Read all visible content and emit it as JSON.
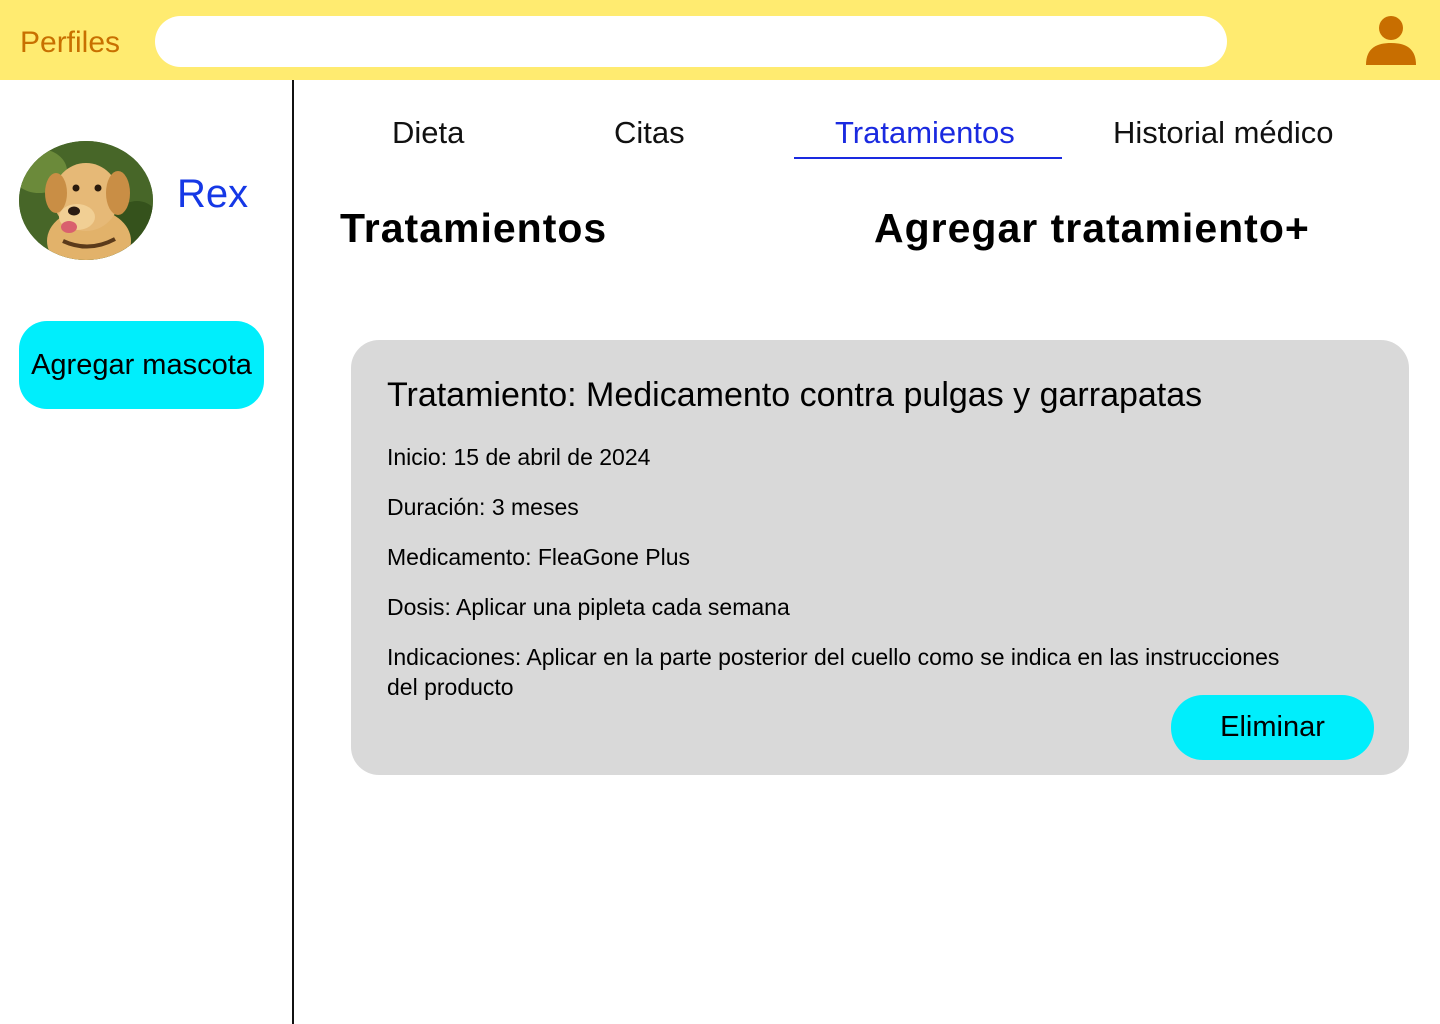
{
  "header": {
    "title": "Perfiles",
    "search_placeholder": "",
    "user_icon": "user-icon"
  },
  "sidebar": {
    "pet_name": "Rex",
    "avatar": "dog-photo",
    "add_pet_label": "Agregar mascota"
  },
  "tabs": [
    {
      "label": "Dieta",
      "active": false
    },
    {
      "label": "Citas",
      "active": false
    },
    {
      "label": "Tratamientos",
      "active": true
    },
    {
      "label": "Historial médico",
      "active": false
    }
  ],
  "main": {
    "section_title": "Tratamientos",
    "add_treatment_label": "Agregar tratamiento+"
  },
  "treatment": {
    "title": "Tratamiento: Medicamento contra pulgas y garrapatas",
    "inicio": "Inicio: 15 de abril de 2024",
    "duracion": "Duración: 3 meses",
    "medicamento": "Medicamento: FleaGone Plus",
    "dosis": "Dosis: Aplicar una pipleta cada semana",
    "indicaciones": "Indicaciones: Aplicar en la parte posterior del cuello como se indica en las instrucciones del producto",
    "delete_label": "Eliminar"
  },
  "colors": {
    "header_bg": "#ffeb70",
    "title_color": "#c87000",
    "accent_blue": "#1a2ae0",
    "button_cyan": "#00eefc",
    "card_bg": "#d9d9d9"
  }
}
